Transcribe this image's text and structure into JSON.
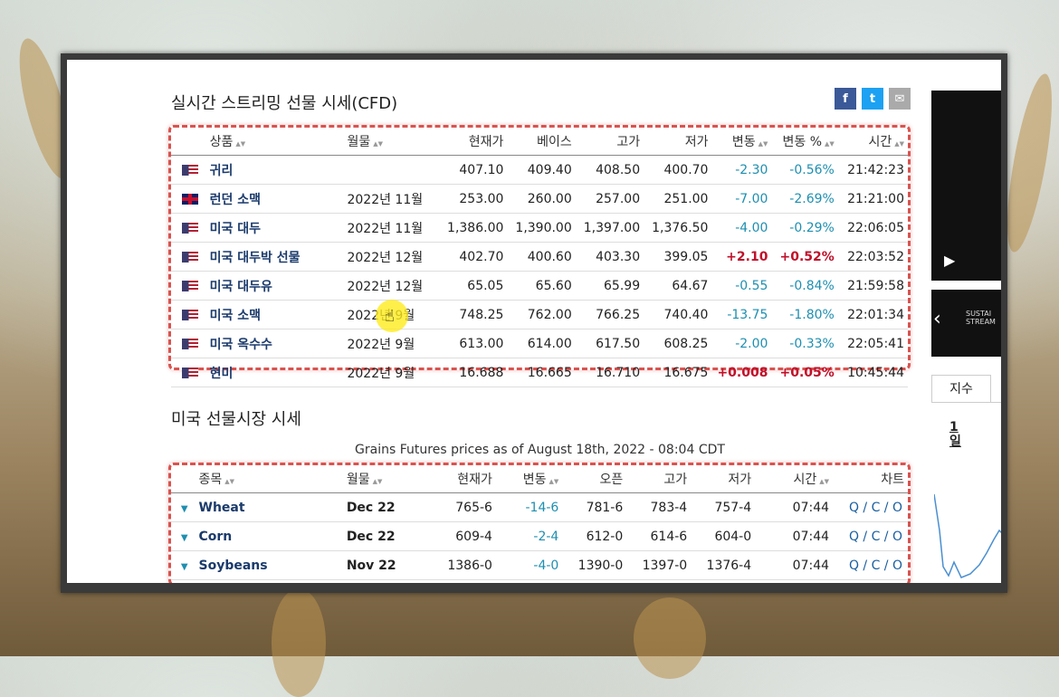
{
  "cfd": {
    "title": "실시간 스트리밍 선물 시세(CFD)",
    "headers": [
      "상품",
      "월물",
      "현재가",
      "베이스",
      "고가",
      "저가",
      "변동",
      "변동 %",
      "시간"
    ],
    "rows": [
      {
        "flag": "us",
        "name": "귀리",
        "month": "",
        "cur": "407.10",
        "base": "409.40",
        "high": "408.50",
        "low": "400.70",
        "chg": "-2.30",
        "pct": "-0.56%",
        "time": "21:42:23",
        "dir": "neg"
      },
      {
        "flag": "gb",
        "name": "런던 소맥",
        "month": "2022년 11월",
        "cur": "253.00",
        "base": "260.00",
        "high": "257.00",
        "low": "251.00",
        "chg": "-7.00",
        "pct": "-2.69%",
        "time": "21:21:00",
        "dir": "neg"
      },
      {
        "flag": "us",
        "name": "미국 대두",
        "month": "2022년 11월",
        "cur": "1,386.00",
        "base": "1,390.00",
        "high": "1,397.00",
        "low": "1,376.50",
        "chg": "-4.00",
        "pct": "-0.29%",
        "time": "22:06:05",
        "dir": "neg"
      },
      {
        "flag": "us",
        "name": "미국 대두박 선물",
        "month": "2022년 12월",
        "cur": "402.70",
        "base": "400.60",
        "high": "403.30",
        "low": "399.05",
        "chg": "+2.10",
        "pct": "+0.52%",
        "time": "22:03:52",
        "dir": "pos"
      },
      {
        "flag": "us",
        "name": "미국 대두유",
        "month": "2022년 12월",
        "cur": "65.05",
        "base": "65.60",
        "high": "65.99",
        "low": "64.67",
        "chg": "-0.55",
        "pct": "-0.84%",
        "time": "21:59:58",
        "dir": "neg"
      },
      {
        "flag": "us",
        "name": "미국 소맥",
        "month": "2022년 9월",
        "cur": "748.25",
        "base": "762.00",
        "high": "766.25",
        "low": "740.40",
        "chg": "-13.75",
        "pct": "-1.80%",
        "time": "22:01:34",
        "dir": "neg"
      },
      {
        "flag": "us",
        "name": "미국 옥수수",
        "month": "2022년 9월",
        "cur": "613.00",
        "base": "614.00",
        "high": "617.50",
        "low": "608.25",
        "chg": "-2.00",
        "pct": "-0.33%",
        "time": "22:05:41",
        "dir": "neg"
      },
      {
        "flag": "us",
        "name": "현미",
        "month": "2022년 9월",
        "cur": "16.688",
        "base": "16.665",
        "high": "16.710",
        "low": "16.675",
        "chg": "+0.008",
        "pct": "+0.05%",
        "time": "10:45:44",
        "dir": "pos"
      }
    ]
  },
  "us": {
    "title": "미국 선물시장 시세",
    "caption": "Grains Futures prices as of August 18th, 2022 - 08:04 CDT",
    "headers": [
      "종목",
      "월물",
      "현재가",
      "변동",
      "오픈",
      "고가",
      "저가",
      "시간",
      "차트"
    ],
    "rows": [
      {
        "name": "Wheat",
        "month": "Dec 22",
        "cur": "765-6",
        "chg": "-14-6",
        "open": "781-6",
        "high": "783-4",
        "low": "757-4",
        "time": "07:44",
        "chart": "Q / C / O"
      },
      {
        "name": "Corn",
        "month": "Dec 22",
        "cur": "609-4",
        "chg": "-2-4",
        "open": "612-0",
        "high": "614-6",
        "low": "604-0",
        "time": "07:44",
        "chart": "Q / C / O"
      },
      {
        "name": "Soybeans",
        "month": "Nov 22",
        "cur": "1386-0",
        "chg": "-4-0",
        "open": "1390-0",
        "high": "1397-0",
        "low": "1376-4",
        "time": "07:44",
        "chart": "Q / C / O"
      }
    ]
  },
  "side": {
    "tab": "지수",
    "period": "1\n일",
    "promo": "SUSTAI STREAM"
  }
}
